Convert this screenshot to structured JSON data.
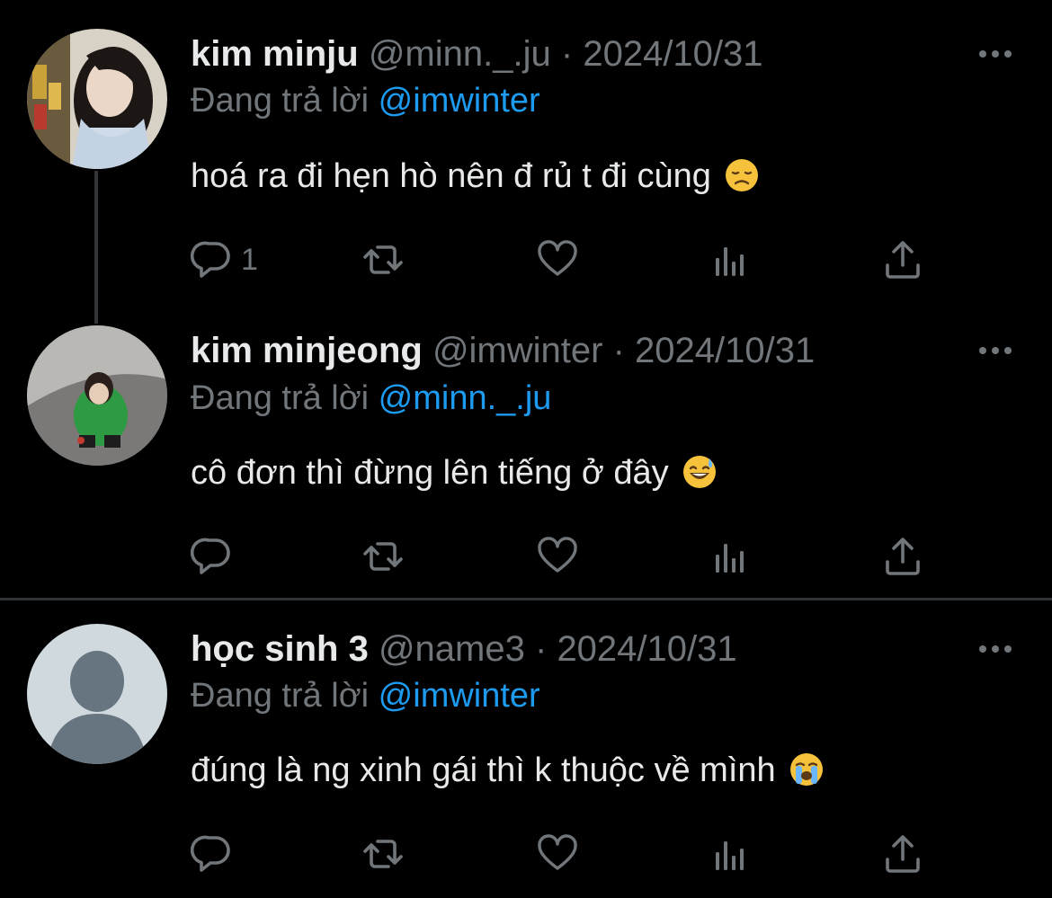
{
  "colors": {
    "background": "#000000",
    "text_primary": "#e7e9ea",
    "text_secondary": "#71767b",
    "mention": "#1d9bf0",
    "divider": "#2f3336",
    "thread_line": "#333639"
  },
  "tweets": [
    {
      "name": "kim minju",
      "handle": "@minn._.ju",
      "separator": "·",
      "date": "2024/10/31",
      "replying_prefix": "Đang trả lời",
      "replying_to": "@imwinter",
      "text": "hoá ra đi hẹn hò nên đ rủ t đi cùng",
      "emoji": "disappointed-face",
      "reply_count": "1"
    },
    {
      "name": "kim minjeong",
      "handle": "@imwinter",
      "separator": "·",
      "date": "2024/10/31",
      "replying_prefix": "Đang trả lời",
      "replying_to": "@minn._.ju",
      "text": "cô đơn thì đừng lên tiếng ở đây",
      "emoji": "grinning-sweat-face",
      "reply_count": ""
    },
    {
      "name": "học sinh 3",
      "handle": "@name3",
      "separator": "·",
      "date": "2024/10/31",
      "replying_prefix": "Đang trả lời",
      "replying_to": "@imwinter",
      "text": "đúng là ng xinh gái thì k thuộc về mình",
      "emoji": "loudly-crying-face",
      "reply_count": ""
    }
  ],
  "icons": {
    "more": "more-horizontal-icon",
    "reply": "reply-bubble-icon",
    "retweet": "retweet-icon",
    "like": "heart-icon",
    "views": "views-bar-chart-icon",
    "share": "share-upload-icon"
  }
}
